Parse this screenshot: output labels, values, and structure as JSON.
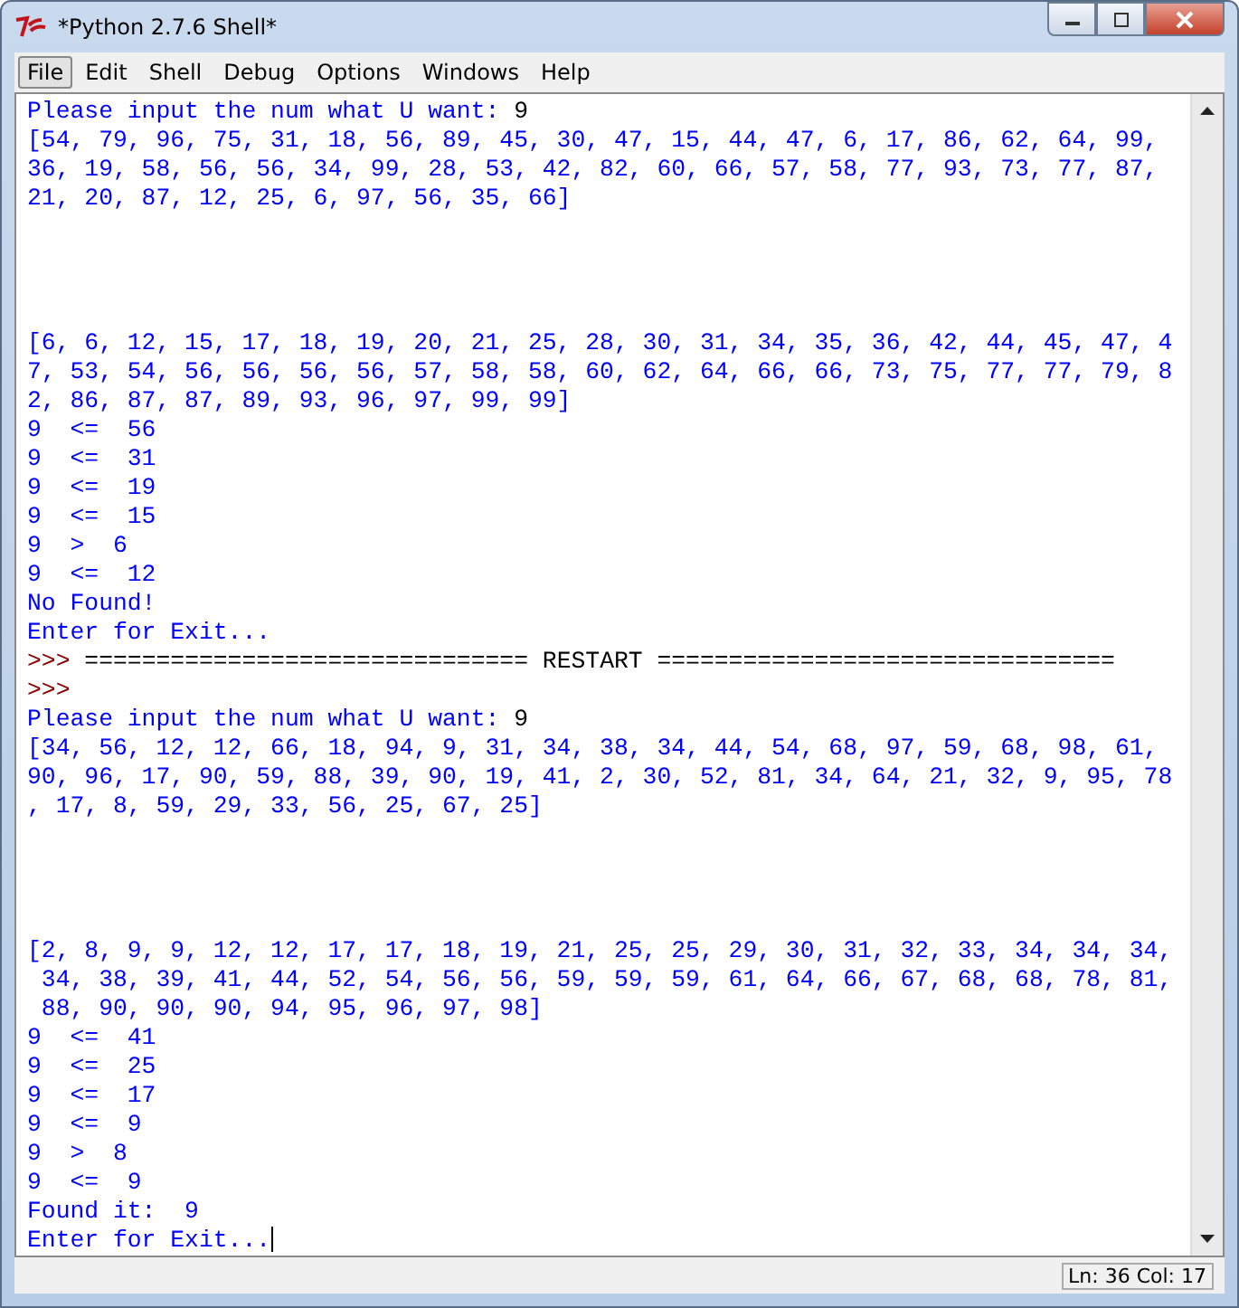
{
  "window": {
    "title": "*Python 2.7.6 Shell*"
  },
  "menu": [
    {
      "label": "File",
      "selected": true
    },
    {
      "label": "Edit",
      "selected": false
    },
    {
      "label": "Shell",
      "selected": false
    },
    {
      "label": "Debug",
      "selected": false
    },
    {
      "label": "Options",
      "selected": false
    },
    {
      "label": "Windows",
      "selected": false
    },
    {
      "label": "Help",
      "selected": false
    }
  ],
  "lines": [
    {
      "kind": "query",
      "text": "Please input the num what U want: ",
      "answer": "9"
    },
    {
      "kind": "output",
      "text": "[54, 79, 96, 75, 31, 18, 56, 89, 45, 30, 47, 15, 44, 47, 6, 17, 86, 62, 64, 99,"
    },
    {
      "kind": "output",
      "text": "36, 19, 58, 56, 56, 34, 99, 28, 53, 42, 82, 60, 66, 57, 58, 77, 93, 73, 77, 87,"
    },
    {
      "kind": "output",
      "text": "21, 20, 87, 12, 25, 6, 97, 56, 35, 66]"
    },
    {
      "kind": "blank"
    },
    {
      "kind": "blank"
    },
    {
      "kind": "blank"
    },
    {
      "kind": "blank"
    },
    {
      "kind": "output",
      "text": "[6, 6, 12, 15, 17, 18, 19, 20, 21, 25, 28, 30, 31, 34, 35, 36, 42, 44, 45, 47, 4"
    },
    {
      "kind": "output",
      "text": "7, 53, 54, 56, 56, 56, 56, 57, 58, 58, 60, 62, 64, 66, 66, 73, 75, 77, 77, 79, 8"
    },
    {
      "kind": "output",
      "text": "2, 86, 87, 87, 89, 93, 96, 97, 99, 99]"
    },
    {
      "kind": "output",
      "text": "9  <=  56"
    },
    {
      "kind": "output",
      "text": "9  <=  31"
    },
    {
      "kind": "output",
      "text": "9  <=  19"
    },
    {
      "kind": "output",
      "text": "9  <=  15"
    },
    {
      "kind": "output",
      "text": "9  >  6"
    },
    {
      "kind": "output",
      "text": "9  <=  12"
    },
    {
      "kind": "output",
      "text": "No Found!"
    },
    {
      "kind": "output",
      "text": "Enter for Exit..."
    },
    {
      "kind": "restart",
      "prompt": ">>>",
      "text": "=============================== RESTART ================================"
    },
    {
      "kind": "prompt",
      "prompt": ">>>"
    },
    {
      "kind": "query",
      "text": "Please input the num what U want: ",
      "answer": "9"
    },
    {
      "kind": "output",
      "text": "[34, 56, 12, 12, 66, 18, 94, 9, 31, 34, 38, 34, 44, 54, 68, 97, 59, 68, 98, 61,"
    },
    {
      "kind": "output",
      "text": "90, 96, 17, 90, 59, 88, 39, 90, 19, 41, 2, 30, 52, 81, 34, 64, 21, 32, 9, 95, 78"
    },
    {
      "kind": "output",
      "text": ", 17, 8, 59, 29, 33, 56, 25, 67, 25]"
    },
    {
      "kind": "blank"
    },
    {
      "kind": "blank"
    },
    {
      "kind": "blank"
    },
    {
      "kind": "blank"
    },
    {
      "kind": "output",
      "text": "[2, 8, 9, 9, 12, 12, 17, 17, 18, 19, 21, 25, 25, 29, 30, 31, 32, 33, 34, 34, 34,"
    },
    {
      "kind": "output",
      "text": " 34, 38, 39, 41, 44, 52, 54, 56, 56, 59, 59, 59, 61, 64, 66, 67, 68, 68, 78, 81,"
    },
    {
      "kind": "output",
      "text": " 88, 90, 90, 90, 94, 95, 96, 97, 98]"
    },
    {
      "kind": "output",
      "text": "9  <=  41"
    },
    {
      "kind": "output",
      "text": "9  <=  25"
    },
    {
      "kind": "output",
      "text": "9  <=  17"
    },
    {
      "kind": "output",
      "text": "9  <=  9"
    },
    {
      "kind": "output",
      "text": "9  >  8"
    },
    {
      "kind": "output",
      "text": "9  <=  9"
    },
    {
      "kind": "output",
      "text": "Found it:  9"
    },
    {
      "kind": "cursor",
      "text": "Enter for Exit..."
    }
  ],
  "status_bar": {
    "position": "Ln: 36 Col: 17"
  }
}
